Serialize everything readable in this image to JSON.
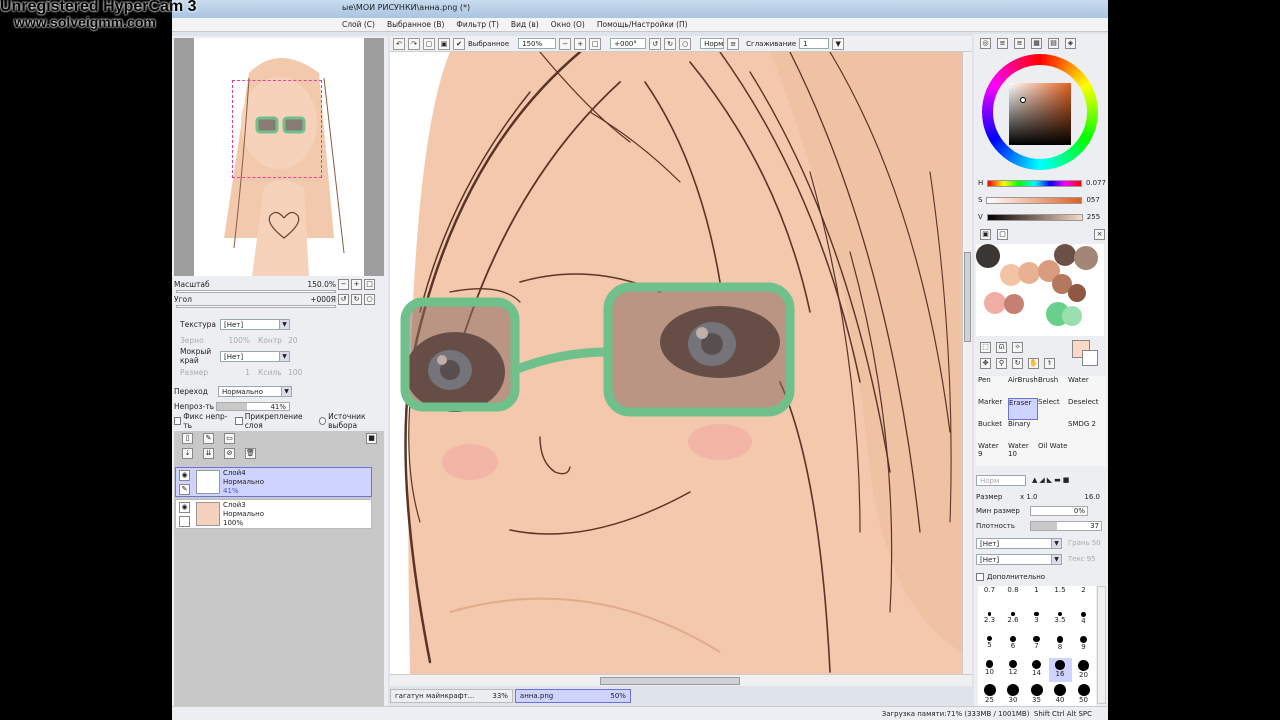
{
  "watermark": {
    "line1": "Unregistered HyperCam 3",
    "line2": "www.solveigmm.com"
  },
  "window": {
    "title": "ые\\МОИ РИСУНКИ\\анна.png (*)"
  },
  "menu": {
    "items": [
      "Слой (C)",
      "Выбранное (В)",
      "Фильтр (T)",
      "Вид (в)",
      "Окно (О)",
      "Помощь/Настройки (П)"
    ]
  },
  "navigator": {
    "zoom_label": "Масштаб",
    "zoom_value": "150.0%",
    "angle_label": "Угол",
    "angle_value": "+000Я"
  },
  "texture": {
    "label": "Текстура",
    "value": "[Нет]",
    "grain_label": "Зерно",
    "grain_value": "100%",
    "contrast_label": "Контр",
    "contrast_value": "20"
  },
  "wet_edge": {
    "label": "Мокрый край",
    "value": "[Нет]",
    "size_label": "Размер",
    "size_value": "1",
    "k_label": "Ксиль",
    "k_value": "100"
  },
  "blend": {
    "label": "Переход",
    "value": "Нормально"
  },
  "opacity": {
    "label": "Непроз-ть",
    "value": "41%",
    "fraction": 0.41
  },
  "checks": {
    "fix_opacity": "Фикс непр-ть",
    "clip": "Прикрепление слоя",
    "source": "Источник выбора"
  },
  "layers": [
    {
      "name": "Слой4",
      "mode": "Нормально",
      "opacity": "41%"
    },
    {
      "name": "Слой3",
      "mode": "Нормально",
      "opacity": "100%"
    }
  ],
  "canvas_toolbar": {
    "selected_label": "Выбранное",
    "zoom": "150%",
    "angle": "+000°",
    "normal": "Норм",
    "smoothing_label": "Сглаживание",
    "smoothing_value": "1"
  },
  "doc_tabs": [
    {
      "name": "гагатун майнкрафт...",
      "zoom": "33%"
    },
    {
      "name": "анна.png",
      "zoom": "50%"
    }
  ],
  "hsv": {
    "h_label": "H",
    "h_value": "0.077",
    "s_label": "S",
    "s_value": "057",
    "v_label": "V",
    "v_value": "255"
  },
  "colors": {
    "accent": "#cfd3ff",
    "skin": "#f3c8ad",
    "glasses": "#6fc08a",
    "hair_line": "#5a3525"
  },
  "tools": {
    "row0": [
      "Pen",
      "AirBrush",
      "Brush",
      "Water"
    ],
    "row1": [
      "Marker",
      "Eraser",
      "Select",
      "Deselect"
    ],
    "row2": [
      "Bucket",
      "Binary",
      "",
      "SMDG 2"
    ],
    "row3": [
      "Water",
      "Water",
      "Oil Wate",
      ""
    ],
    "row3_sub": [
      "9",
      "10",
      "",
      ""
    ]
  },
  "brush_props": {
    "norm": "Норм",
    "size_label": "Размер",
    "size_mult": "x 1.0",
    "size_value": "16.0",
    "min_size_label": "Мин размер",
    "min_size_value": "0%",
    "density_label": "Плотность",
    "density_value": "37",
    "shape1": "[Нет]",
    "shape2": "[Нет]",
    "shape1_sub": "Грань",
    "shape1_sub_val": "50",
    "shape2_sub": "Текс",
    "shape2_sub_val": "95",
    "advanced": "Дополнительно"
  },
  "size_presets": [
    "0.7",
    "0.8",
    "1",
    "1.5",
    "2",
    "2.3",
    "2.6",
    "3",
    "3.5",
    "4",
    "5",
    "6",
    "7",
    "8",
    "9",
    "10",
    "12",
    "14",
    "16",
    "20",
    "25",
    "30",
    "35",
    "40",
    "50"
  ],
  "status": {
    "memory": "Загрузка памяти:71% (333MB / 1001MB)",
    "keys": "Shift Ctrl Alt SPC"
  }
}
